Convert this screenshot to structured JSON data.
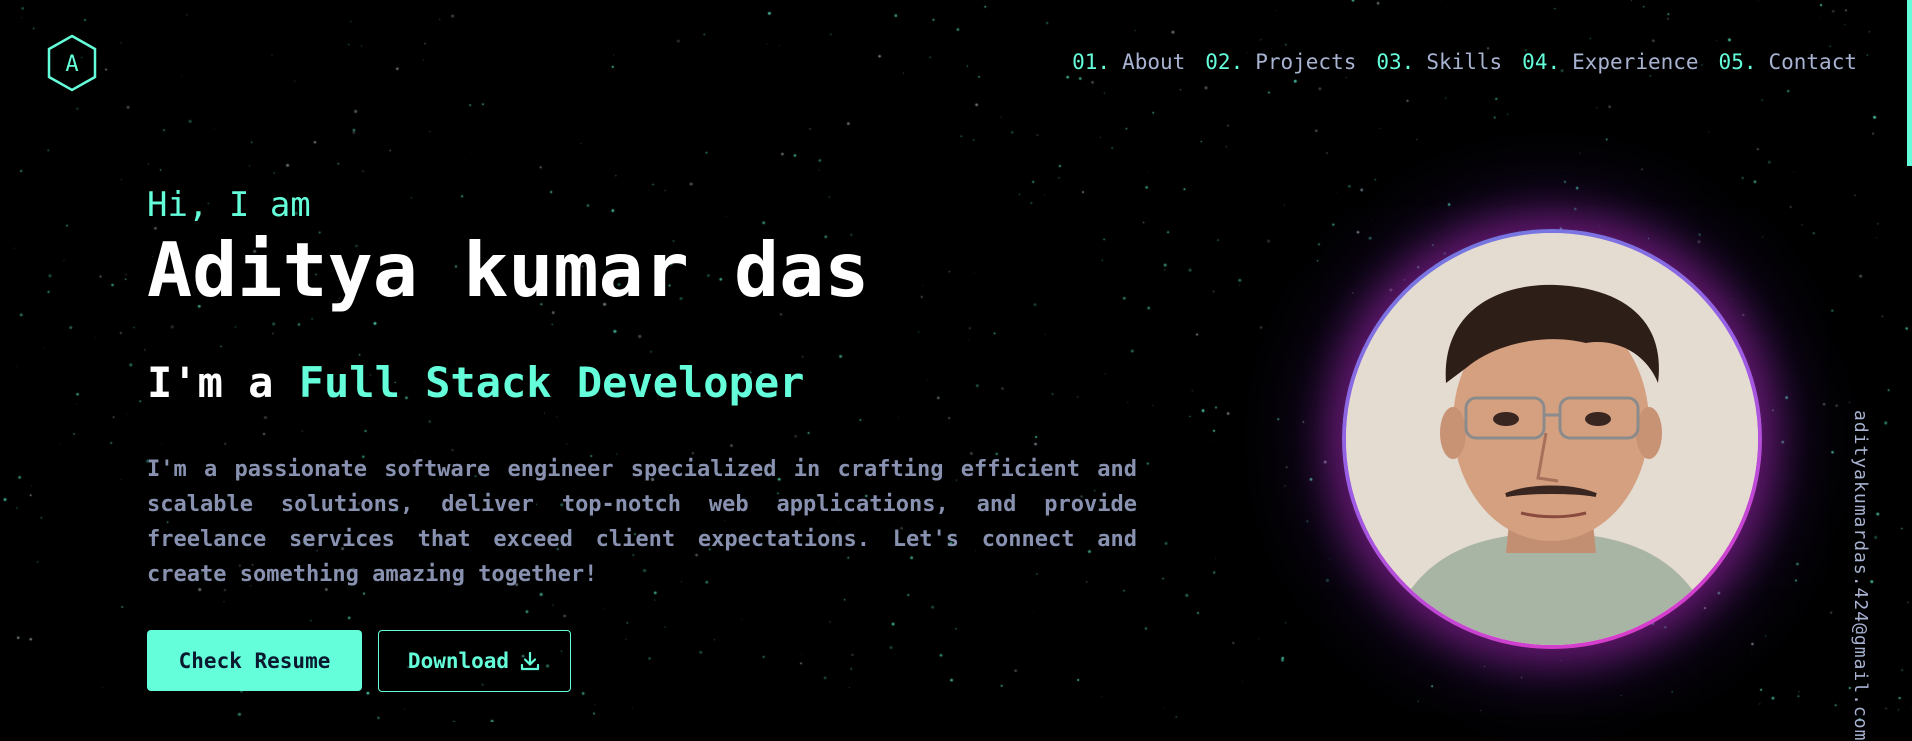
{
  "nav": {
    "items": [
      {
        "num": "01.",
        "label": "About"
      },
      {
        "num": "02.",
        "label": "Projects"
      },
      {
        "num": "03.",
        "label": "Skills"
      },
      {
        "num": "04.",
        "label": "Experience"
      },
      {
        "num": "05.",
        "label": "Contact"
      }
    ]
  },
  "logo": {
    "letter": "A",
    "icon": "hexagon-logo-icon"
  },
  "hero": {
    "greeting": "Hi, I am",
    "name": "Aditya kumar das",
    "role_prefix": "I'm a ",
    "role": "Full Stack Developer",
    "bio": "I'm a passionate software engineer specialized in crafting efficient and scalable solutions, deliver top-notch web applications, and provide freelance services that exceed client expectations. Let's connect and create something amazing together!",
    "resume_button": "Check Resume",
    "download_button": "Download",
    "download_icon": "download-icon"
  },
  "side": {
    "email": "adityakumardas.424@gmail.com"
  },
  "colors": {
    "accent": "#64ffda",
    "background": "#000000",
    "text": "#ffffff",
    "muted": "#8892b0",
    "nav_text": "#a8b2d1",
    "avatar_ring_start": "#6b7fe0",
    "avatar_ring_end": "#e535c5"
  }
}
